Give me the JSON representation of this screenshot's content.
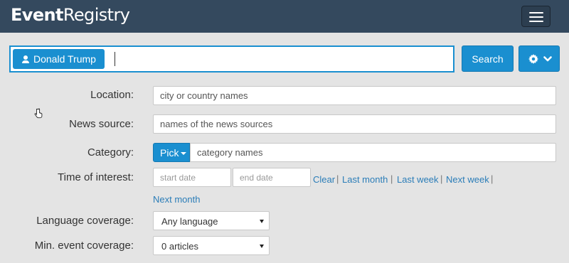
{
  "navbar": {
    "brand_bold": "Event",
    "brand_regular": "Registry",
    "menu_icon": "hamburger-icon"
  },
  "search": {
    "concept_tag": "Donald Trump",
    "concept_icon": "person-icon",
    "keyword_value": "",
    "search_label": "Search",
    "settings_icon": "gear-icon",
    "settings_caret_icon": "chevron-down-icon"
  },
  "form": {
    "location": {
      "label": "Location:",
      "placeholder": "city or country names"
    },
    "news_source": {
      "label": "News source:",
      "placeholder": "names of the news sources"
    },
    "category": {
      "label": "Category:",
      "pick_label": "Pick",
      "placeholder": "category names"
    },
    "time": {
      "label": "Time of interest:",
      "start_placeholder": "start date",
      "end_placeholder": "end date",
      "links": [
        "Clear",
        "Last month",
        "Last week",
        "Next week",
        "Next month"
      ],
      "separator": "|"
    },
    "language": {
      "label": "Language coverage:",
      "value": "Any language"
    },
    "min_coverage": {
      "label": "Min. event coverage:",
      "value": "0 articles"
    }
  },
  "colors": {
    "navbar": "#34495e",
    "accent": "#1a8fd0",
    "background": "#e4e4e4",
    "link": "#2b7db8"
  }
}
